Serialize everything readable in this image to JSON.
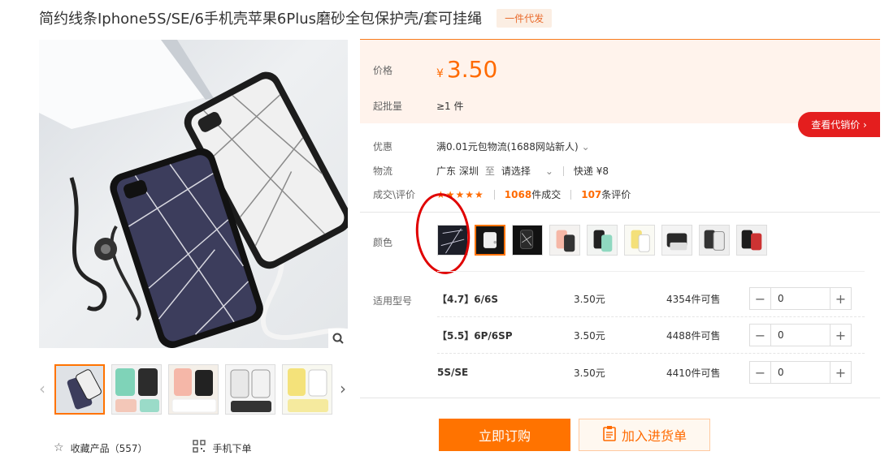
{
  "product": {
    "title": "简约线条Iphone5S/SE/6手机壳苹果6Plus磨砂全包保护壳/套可挂绳",
    "badge": "一件代发"
  },
  "gallery": {
    "zoom_icon": "search-icon",
    "prev_icon": "chevron-left-icon",
    "next_icon": "chevron-right-icon",
    "prev_glyph": "‹",
    "next_glyph": "›"
  },
  "bottom_links": {
    "favorite_icon": "star-outline-icon",
    "favorite_label": "收藏产品（557）",
    "qr_icon": "qr-code-icon",
    "mobile_label": "手机下单"
  },
  "price": {
    "label": "价格",
    "currency": "¥",
    "value": "3.50",
    "moq_label": "起批量",
    "moq_value": "≥1 件"
  },
  "agent_button": "查看代销价 ›",
  "info": {
    "promo_label": "优惠",
    "promo_value": "满0.01元包物流(1688网站新人)",
    "shipping_label": "物流",
    "ship_from": "广东 深圳",
    "ship_to_word": "至",
    "ship_to": "请选择",
    "express": "快递 ¥8",
    "deals_label": "成交\\评价",
    "stars": "★★★★★",
    "deals_count": "1068",
    "deals_unit": "件成交",
    "reviews_count": "107",
    "reviews_unit": "条评价"
  },
  "color": {
    "label": "颜色",
    "selected_index": 1
  },
  "models": {
    "label": "适用型号",
    "rows": [
      {
        "name": "【4.7】6/6S",
        "price": "3.50元",
        "stock": "4354件可售",
        "qty": "0"
      },
      {
        "name": "【5.5】6P/6SP",
        "price": "3.50元",
        "stock": "4488件可售",
        "qty": "0"
      },
      {
        "name": "5S/SE",
        "price": "3.50元",
        "stock": "4410件可售",
        "qty": "0"
      }
    ]
  },
  "actions": {
    "buy_label": "立即订购",
    "cart_label": "加入进货单",
    "cart_icon": "clipboard-icon"
  },
  "colors": {
    "accent": "#ff7300",
    "price": "#ff6a00",
    "agent_red": "#e41e1e",
    "annotation_red": "#e00000"
  }
}
